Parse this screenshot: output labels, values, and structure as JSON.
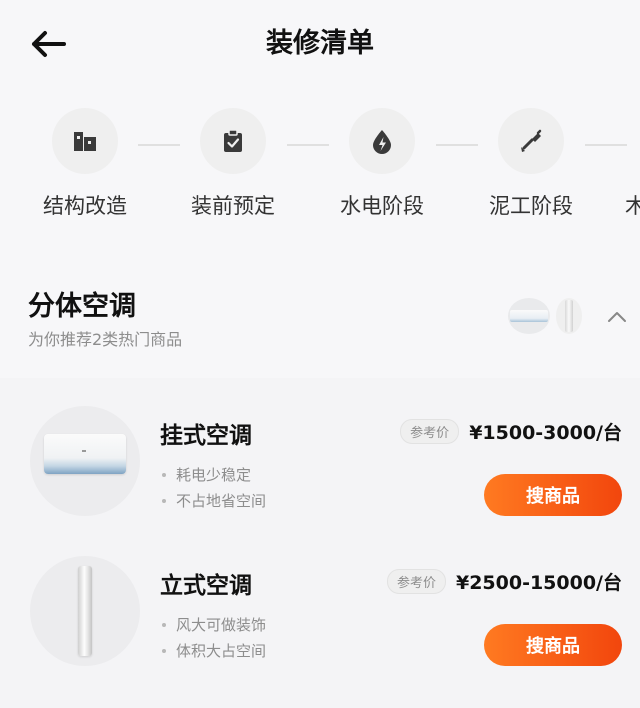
{
  "header": {
    "title": "装修清单",
    "back_icon": "arrow-left-icon"
  },
  "stages": [
    {
      "label": "结构改造",
      "icon": "structure-icon"
    },
    {
      "label": "装前预定",
      "icon": "clipboard-check-icon"
    },
    {
      "label": "水电阶段",
      "icon": "water-electric-icon"
    },
    {
      "label": "泥工阶段",
      "icon": "trowel-icon"
    },
    {
      "label": "木",
      "icon": "wood-icon"
    }
  ],
  "category": {
    "title": "分体空调",
    "subtitle": "为你推荐2类热门商品",
    "expanded": true
  },
  "products": [
    {
      "name": "挂式空调",
      "features": [
        "耗电少稳定",
        "不占地省空间"
      ],
      "price_badge": "参考价",
      "price": "¥1500-3000/台",
      "button": "搜商品"
    },
    {
      "name": "立式空调",
      "features": [
        "风大可做装饰",
        "体积大占空间"
      ],
      "price_badge": "参考价",
      "price": "¥2500-15000/台",
      "button": "搜商品"
    }
  ],
  "colors": {
    "accent_start": "#ff7a21",
    "accent_end": "#f2460d",
    "background": "#f7f7f9"
  }
}
